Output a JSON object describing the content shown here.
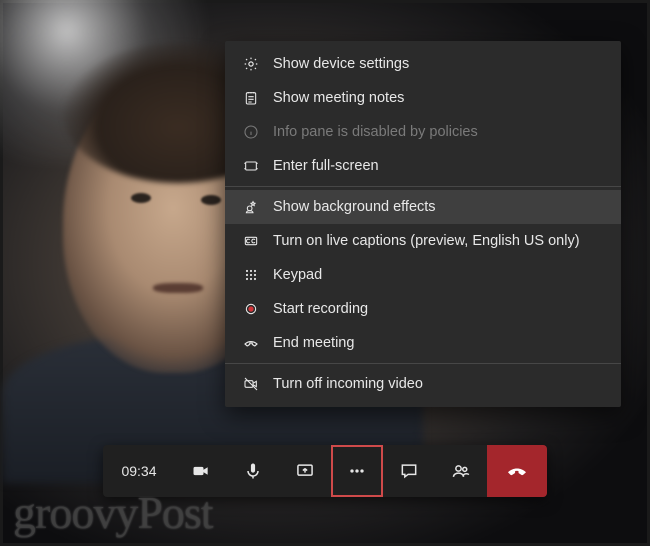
{
  "menu": {
    "device_settings": "Show device settings",
    "meeting_notes": "Show meeting notes",
    "info_pane_disabled": "Info pane is disabled by policies",
    "fullscreen": "Enter full-screen",
    "background_effects": "Show background effects",
    "live_captions": "Turn on live captions (preview, English US only)",
    "keypad": "Keypad",
    "start_recording": "Start recording",
    "end_meeting": "End meeting",
    "incoming_video_off": "Turn off incoming video"
  },
  "toolbar": {
    "timer": "09:34"
  },
  "watermark": "groovyPost",
  "colors": {
    "menu_bg": "#2b2b2b",
    "menu_highlight": "#3f3f3f",
    "toolbar_bg": "#202020",
    "hangup": "#a4262c",
    "active_outline": "#cf4a4a",
    "record": "#d13438"
  }
}
